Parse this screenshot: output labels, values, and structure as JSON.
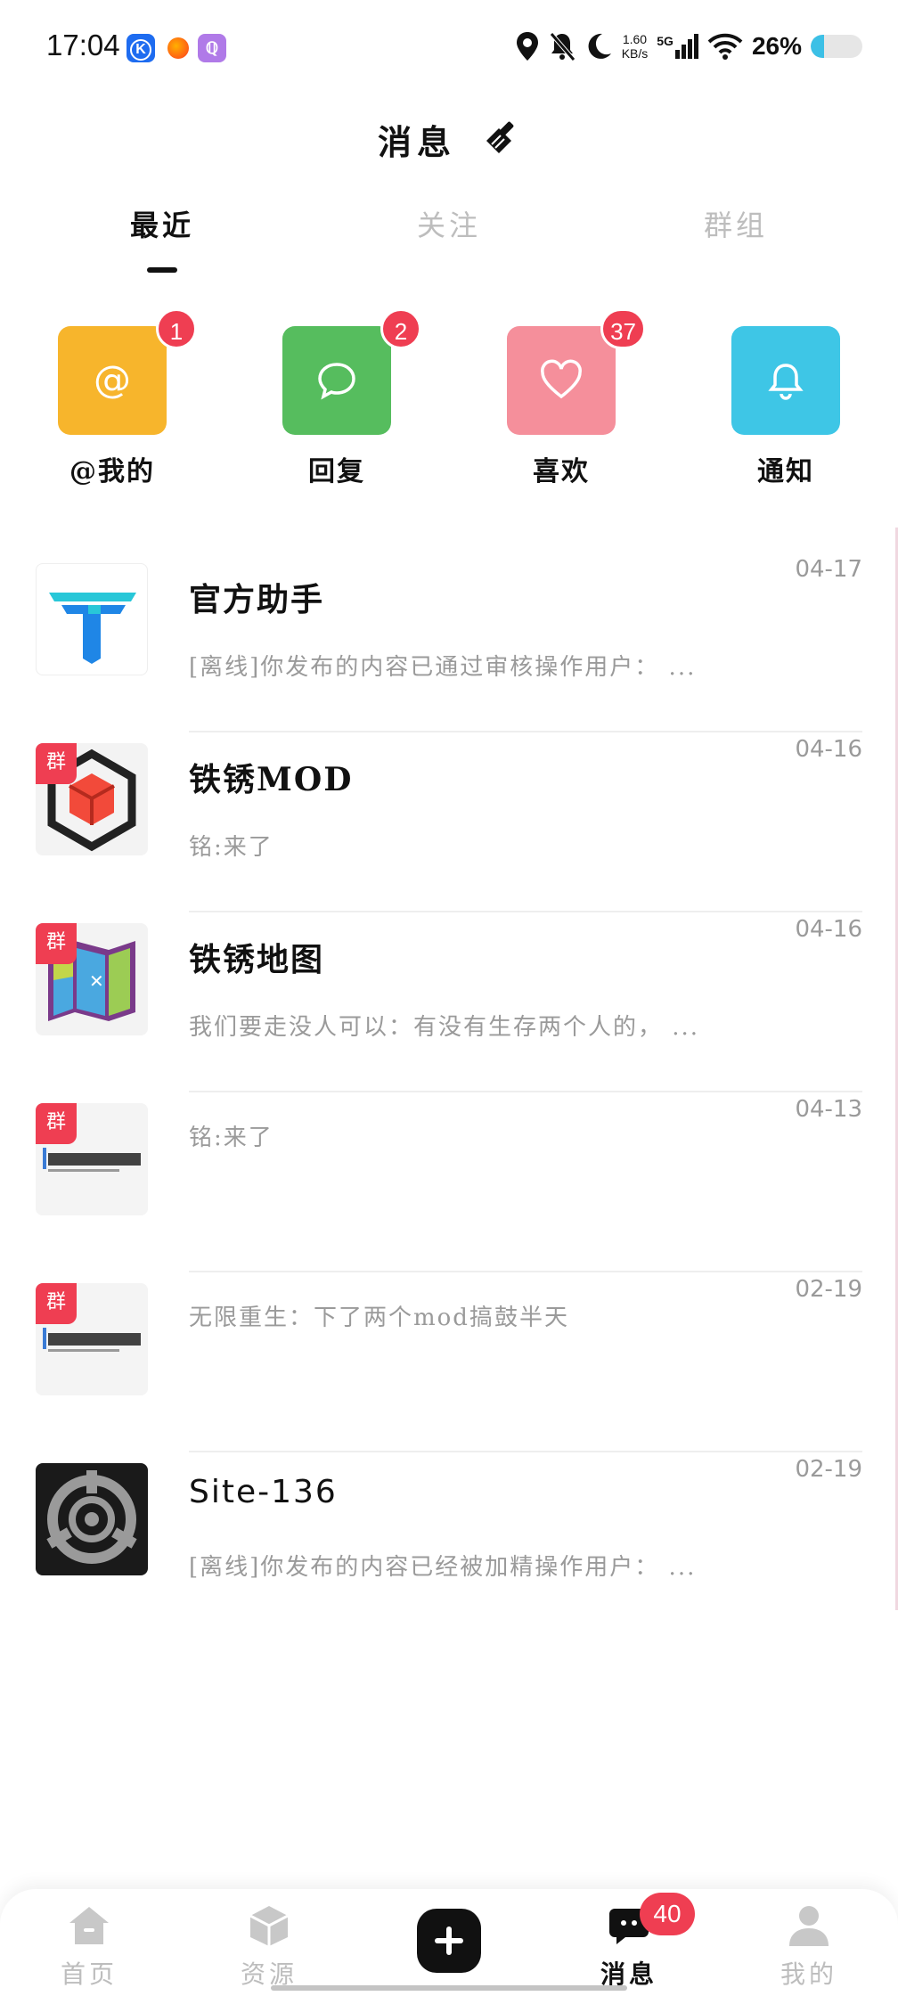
{
  "status_bar": {
    "time": "17:04",
    "speed_value": "1.60",
    "speed_unit": "KB/s",
    "network": "5G",
    "battery": "26%",
    "battery_level": 0.26
  },
  "header": {
    "title": "消息"
  },
  "tabs": [
    {
      "label": "最近",
      "active": true
    },
    {
      "label": "关注",
      "active": false
    },
    {
      "label": "群组",
      "active": false
    }
  ],
  "quick_actions": [
    {
      "label": "@我的",
      "badge": "1",
      "color": "#f7b52c",
      "icon": "at-icon"
    },
    {
      "label": "回复",
      "badge": "2",
      "color": "#56bd5e",
      "icon": "comment-icon"
    },
    {
      "label": "喜欢",
      "badge": "37",
      "color": "#f58f9b",
      "icon": "heart-icon"
    },
    {
      "label": "通知",
      "badge": "",
      "color": "#3ec6e6",
      "icon": "bell-icon"
    }
  ],
  "conversations": [
    {
      "title": "官方助手",
      "preview": "[离线]你发布的内容已通过审核操作用户： ...",
      "time": "04-17",
      "group": false
    },
    {
      "title": "铁锈MOD",
      "preview": "铭:来了",
      "time": "04-16",
      "group": true,
      "group_tag": "群"
    },
    {
      "title": "铁锈地图",
      "preview": "我们要走没人可以：有没有生存两个人的， ...",
      "time": "04-16",
      "group": true,
      "group_tag": "群"
    },
    {
      "title": "",
      "preview": "铭:来了",
      "time": "04-13",
      "group": true,
      "group_tag": "群"
    },
    {
      "title": "",
      "preview": "无限重生：下了两个mod搞鼓半天",
      "time": "02-19",
      "group": true,
      "group_tag": "群"
    },
    {
      "title": "Site-136",
      "preview": "[离线]你发布的内容已经被加精操作用户： ...",
      "time": "02-19",
      "group": false
    }
  ],
  "bottom_nav": {
    "items": [
      {
        "label": "首页",
        "active": false
      },
      {
        "label": "资源",
        "active": false
      },
      {
        "label": "消息",
        "active": true,
        "badge": "40"
      },
      {
        "label": "我的",
        "active": false
      }
    ]
  },
  "colors": {
    "accent_red": "#ef3e52",
    "inactive": "#bdbdbd"
  }
}
